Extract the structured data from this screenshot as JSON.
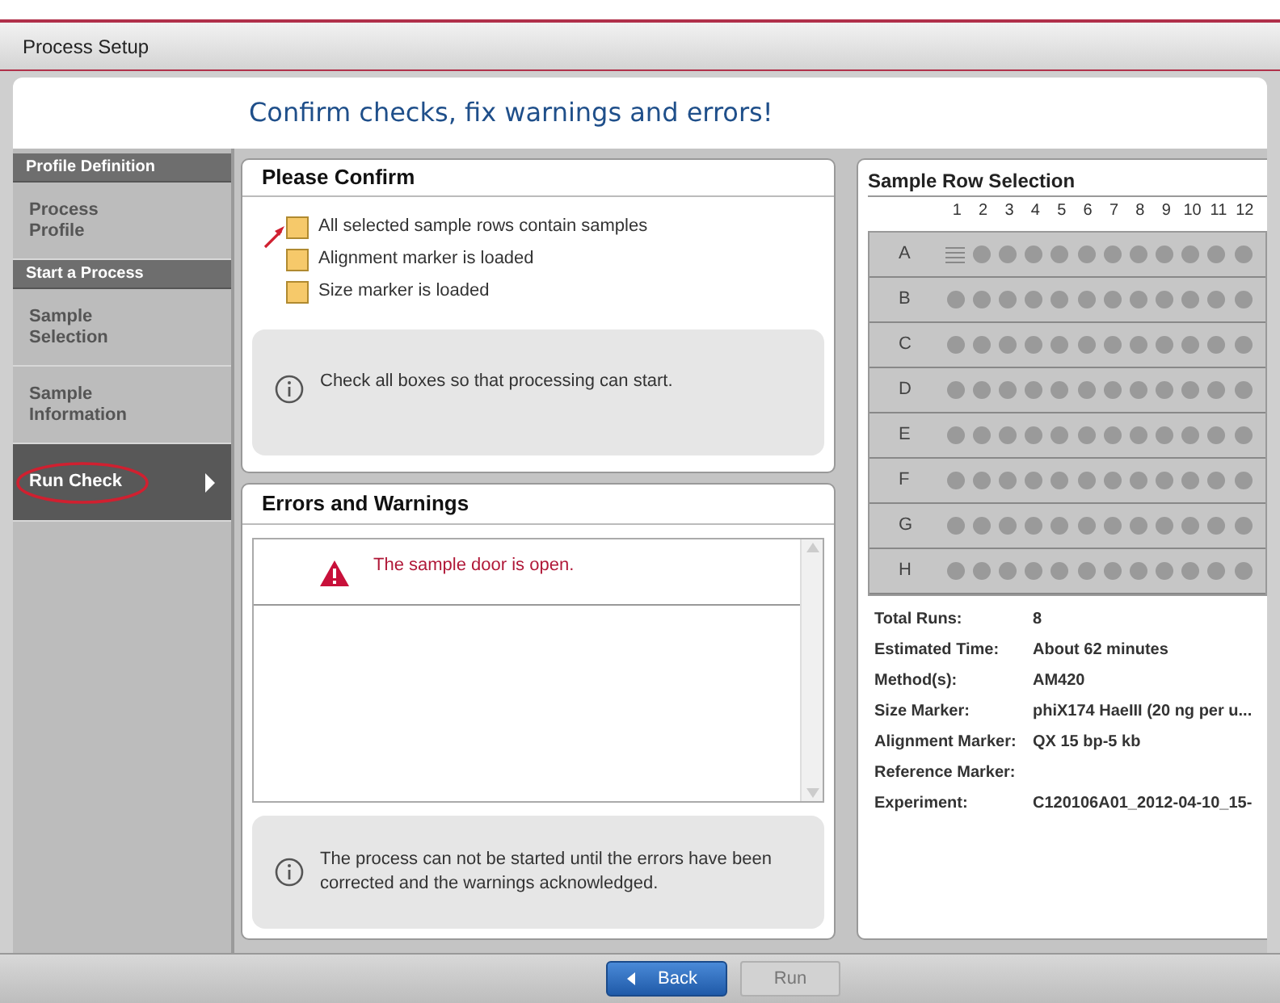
{
  "window": {
    "title": "Process Setup"
  },
  "heading": "Confirm checks, fix warnings and errors!",
  "sidebar": {
    "items": [
      {
        "kind": "header",
        "label": "Profile Definition"
      },
      {
        "kind": "item",
        "label": "Process Profile",
        "selected": false
      },
      {
        "kind": "header",
        "label": "Start a Process"
      },
      {
        "kind": "item",
        "label": "Sample Selection",
        "selected": false
      },
      {
        "kind": "item",
        "label": "Sample Information",
        "selected": false
      },
      {
        "kind": "item",
        "label": "Run Check",
        "selected": true
      }
    ]
  },
  "confirm_panel": {
    "title": "Please Confirm",
    "checks": [
      {
        "label": "All selected sample rows contain samples",
        "checked": false
      },
      {
        "label": "Alignment marker is loaded",
        "checked": false
      },
      {
        "label": "Size marker is loaded",
        "checked": false
      }
    ],
    "info": "Check all boxes so that processing can start."
  },
  "errors_panel": {
    "title": "Errors and Warnings",
    "messages": [
      {
        "kind": "error",
        "text": "The sample door is open."
      }
    ],
    "info": "The process can not be started until the errors have been corrected and the warnings acknowledged."
  },
  "sample_row_selection": {
    "title": "Sample Row Selection",
    "columns": [
      "1",
      "2",
      "3",
      "4",
      "5",
      "6",
      "7",
      "8",
      "9",
      "10",
      "11",
      "12"
    ],
    "rows": [
      {
        "label": "A",
        "ladder": true
      },
      {
        "label": "B",
        "ladder": false
      },
      {
        "label": "C",
        "ladder": false
      },
      {
        "label": "D",
        "ladder": false
      },
      {
        "label": "E",
        "ladder": false
      },
      {
        "label": "F",
        "ladder": false
      },
      {
        "label": "G",
        "ladder": false
      },
      {
        "label": "H",
        "ladder": false
      }
    ],
    "details": [
      {
        "label": "Total Runs:",
        "value": "8"
      },
      {
        "label": "Estimated Time:",
        "value": "About 62 minutes"
      },
      {
        "label": "Method(s):",
        "value": "AM420"
      },
      {
        "label": "Size Marker:",
        "value": "phiX174 HaeIII (20 ng per u..."
      },
      {
        "label": "Alignment Marker:",
        "value": "QX 15 bp-5 kb"
      },
      {
        "label": "Reference Marker:"
      },
      {
        "label": "Experiment:",
        "value": "C120106A01_2012-04-10_15-"
      }
    ]
  },
  "buttons": [
    {
      "label": "Back",
      "disabled": false
    },
    {
      "label": "Run",
      "disabled": true
    }
  ]
}
